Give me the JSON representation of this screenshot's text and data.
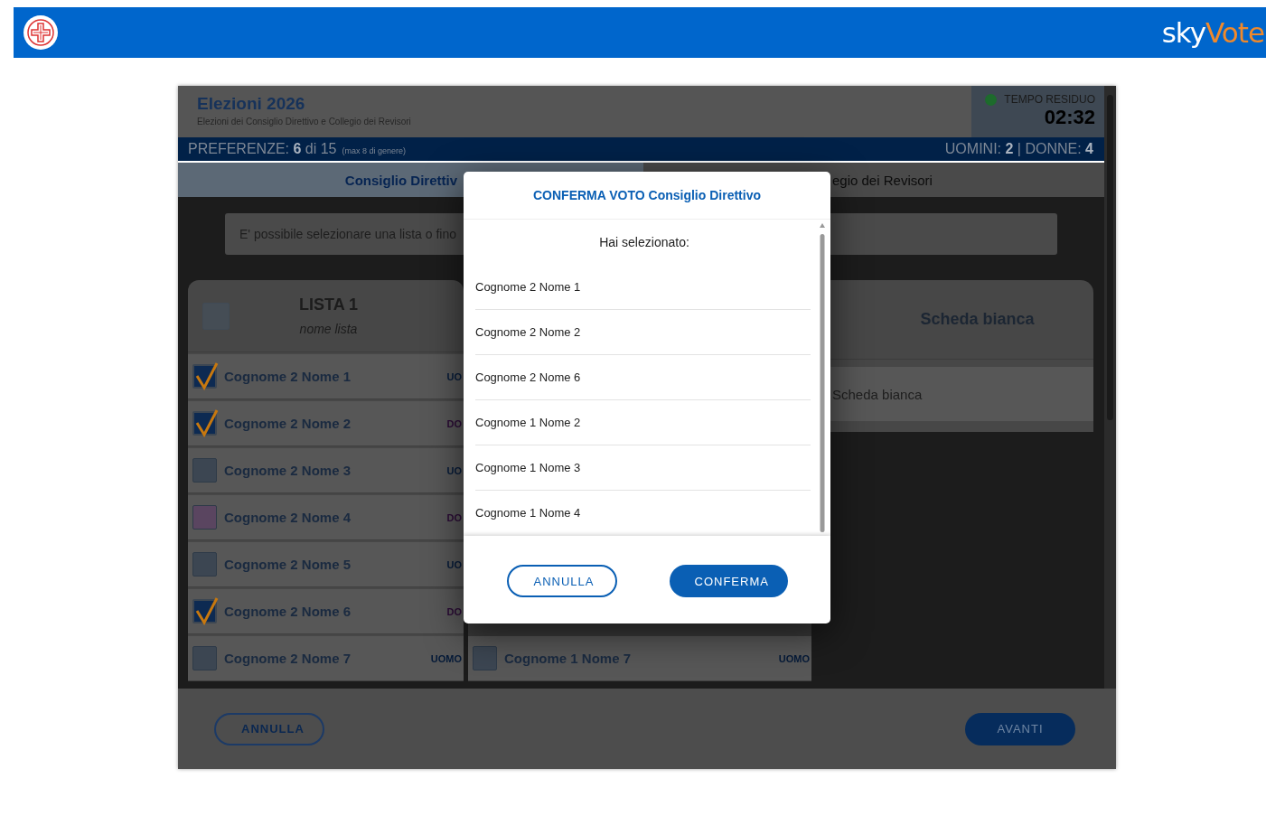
{
  "top_bar": {
    "logo_prefix": "sky",
    "logo_suffix": "Vote"
  },
  "header": {
    "title": "Elezioni 2026",
    "subtitle": "Elezioni dei Consiglio Direttivo e Collegio dei Revisori",
    "timer_label": "TEMPO RESIDUO",
    "timer": "02:32"
  },
  "preferences_bar": {
    "count": "PREFERENZE: **6** di 15",
    "note": "(max 8 di genere)",
    "gender_count": "UOMINI: **2** | DONNE: **4**"
  },
  "tabs": [
    {
      "label": "Consiglio Direttiv",
      "selected": true
    },
    {
      "label": "egio dei Revisori",
      "selected": false
    }
  ],
  "info": "E' possibile selezionare una lista o fino",
  "list_card": {
    "title": "LISTA 1",
    "subtitle": "nome lista",
    "checked": false,
    "candidates": [
      {
        "name": "Cognome 2 Nome 1",
        "gender": "UO",
        "checked": true,
        "color": "#3c4652"
      },
      {
        "name": "Cognome 2 Nome 2",
        "gender": "DO",
        "checked": true,
        "color": "#3c4652"
      },
      {
        "name": "Cognome 2 Nome 3",
        "gender": "UO",
        "checked": false,
        "color": "#3c4652"
      },
      {
        "name": "Cognome 2 Nome 4",
        "gender": "DO",
        "checked": false,
        "color": "#5a4560"
      },
      {
        "name": "Cognome 2 Nome 5",
        "gender": "UO",
        "checked": false,
        "color": "#3c4652"
      },
      {
        "name": "Cognome 2 Nome 6",
        "gender": "DO",
        "checked": true,
        "color": "#3c4652"
      },
      {
        "name": "Cognome 2 Nome 7",
        "gender": "UOMO",
        "checked": false,
        "color": "#3c4652"
      }
    ]
  },
  "second_card": {
    "candidates": [
      {
        "name": "Cognome 1 Nome 7",
        "gender": "UOMO",
        "checked": false,
        "color": "#3c4652"
      }
    ]
  },
  "blank_card": {
    "title": "Scheda bianca",
    "option": "Scheda bianca"
  },
  "footer": {
    "cancel": "ANNULLA",
    "next": "AVANTI"
  },
  "dialog": {
    "title": "CONFERMA VOTO Consiglio Direttivo",
    "intro": "Hai selezionato:",
    "items": [
      "Cognome 2 Nome 1",
      "Cognome 2 Nome 2",
      "Cognome 2 Nome 6",
      "Cognome 1 Nome 2",
      "Cognome 1 Nome 3",
      "Cognome 1 Nome 4"
    ],
    "cancel": "ANNULLA",
    "confirm": "CONFERMA"
  }
}
